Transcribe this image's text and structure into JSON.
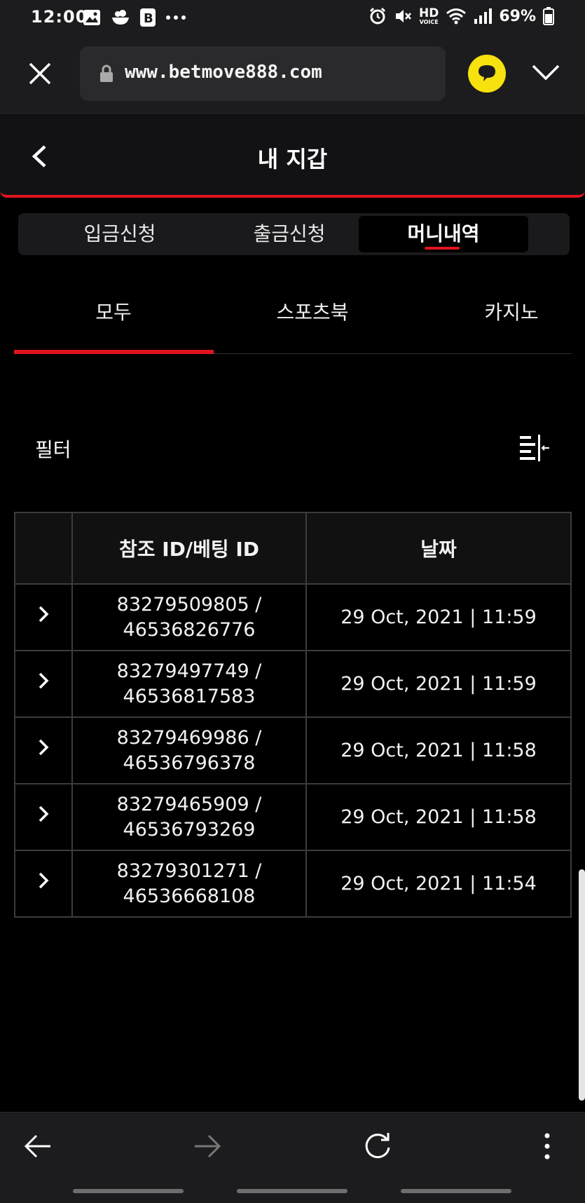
{
  "status_bar": {
    "time": "12:00",
    "battery": "69%",
    "network": "HD",
    "network_sub": "VOICE",
    "icons": [
      "image-icon",
      "cloud-app-icon",
      "b-app-icon",
      "more-dots-icon",
      "alarm-icon",
      "mute-icon",
      "wifi-icon",
      "signal-icon",
      "battery-icon"
    ]
  },
  "browser": {
    "url": "www.betmove888.com",
    "icons": [
      "close-icon",
      "lock-icon",
      "chat-bubble-icon",
      "chevron-down-icon"
    ],
    "accent": "#f7e10e"
  },
  "header": {
    "title": "내 지갑",
    "back_icon": "chevron-left-icon"
  },
  "top_tabs": [
    {
      "label": "입금신청",
      "active": false
    },
    {
      "label": "출금신청",
      "active": false
    },
    {
      "label": "머니내역",
      "active": true
    }
  ],
  "sub_tabs": [
    {
      "label": "모두",
      "active": true
    },
    {
      "label": "스포츠북",
      "active": false
    },
    {
      "label": "카지노",
      "active": false
    }
  ],
  "filter": {
    "label": "필터",
    "icon": "filter-collapse-icon"
  },
  "table": {
    "headers": [
      "",
      "참조 ID/베팅 ID",
      "날짜"
    ],
    "rows": [
      {
        "id1": "83279509805 /",
        "id2": "46536826776",
        "date": "29 Oct, 2021 | 11:59"
      },
      {
        "id1": "83279497749 /",
        "id2": "46536817583",
        "date": "29 Oct, 2021 | 11:59"
      },
      {
        "id1": "83279469986 /",
        "id2": "46536796378",
        "date": "29 Oct, 2021 | 11:58"
      },
      {
        "id1": "83279465909 /",
        "id2": "46536793269",
        "date": "29 Oct, 2021 | 11:58"
      },
      {
        "id1": "83279301271 /",
        "id2": "46536668108",
        "date": "29 Oct, 2021 | 11:54"
      }
    ]
  },
  "bottom_nav": [
    "back-arrow-icon",
    "forward-arrow-icon",
    "reload-icon",
    "more-vertical-icon"
  ],
  "colors": {
    "accent": "#e0141e",
    "background": "#000000",
    "bar": "#1c1c1e"
  }
}
